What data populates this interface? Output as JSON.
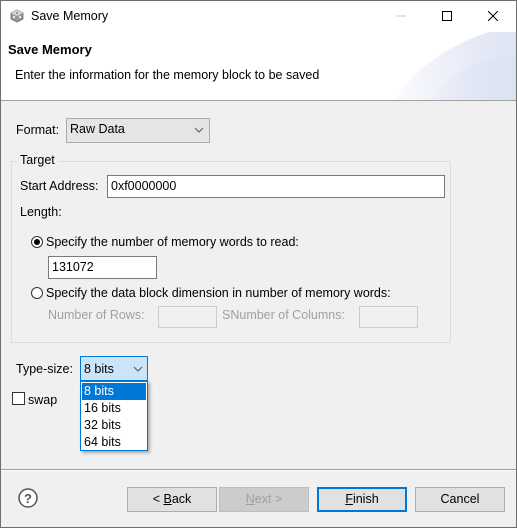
{
  "window": {
    "title": "Save Memory",
    "icon": "memory-cube-icon",
    "controls": [
      "minimize-icon",
      "maximize-icon",
      "close-icon"
    ]
  },
  "header": {
    "title": "Save Memory",
    "description": "Enter the information for the memory block to be saved"
  },
  "format": {
    "label": "Format:",
    "selected": "Raw Data"
  },
  "target": {
    "legend": "Target",
    "start_address_label": "Start Address:",
    "start_address_value": "0xf0000000",
    "length_label": "Length:",
    "option_words": {
      "label": "Specify the number of memory words to read:",
      "selected": true,
      "value": "131072"
    },
    "option_dimension": {
      "label": "Specify the data block dimension in number of memory words:",
      "selected": false,
      "rows_label": "Number of Rows:",
      "rows_value": "",
      "columns_label": "SNumber of Columns:",
      "columns_value": ""
    }
  },
  "type_size": {
    "label": "Type-size:",
    "selected": "8 bits",
    "options": [
      "8 bits",
      "16 bits",
      "32 bits",
      "64 bits"
    ],
    "highlighted_index": 0
  },
  "swap": {
    "label": "swap",
    "checked": false
  },
  "footer": {
    "help_icon": "help-icon",
    "back_prefix": "< ",
    "back_mnemonic": "B",
    "back_rest": "ack",
    "next_mnemonic": "N",
    "next_rest": "ext >",
    "finish_mnemonic": "F",
    "finish_rest": "inish",
    "cancel_label": "Cancel"
  },
  "colors": {
    "accent": "#0078d7",
    "selection_bg": "#cce4f7",
    "disabled_text": "#a0a0a0"
  }
}
